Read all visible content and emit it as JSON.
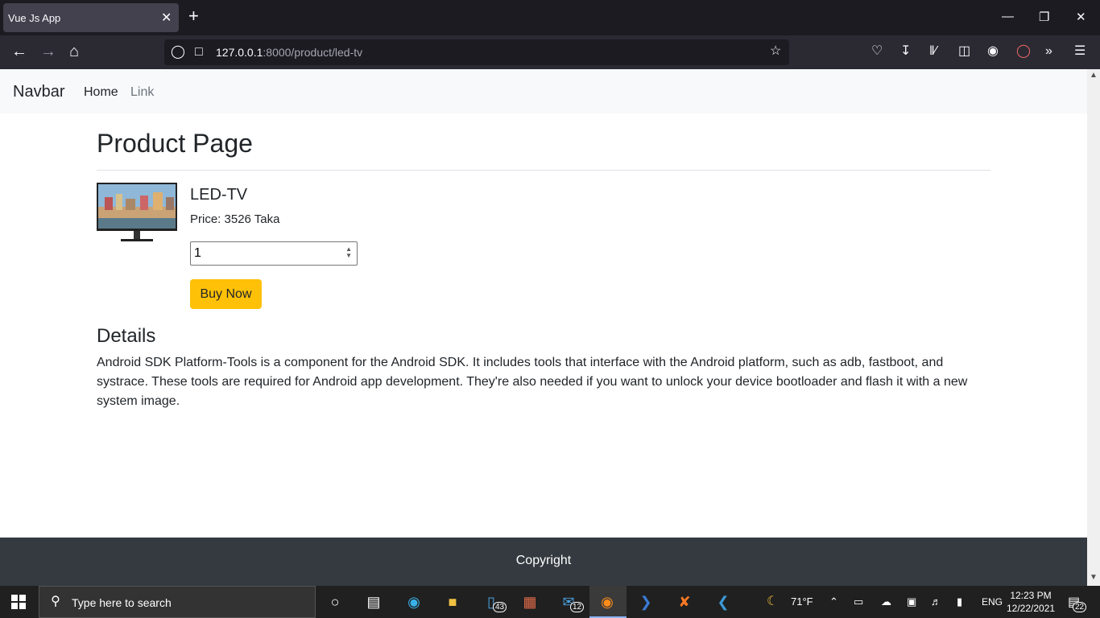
{
  "browser": {
    "tab_title": "Vue Js App",
    "tab_close": "✕",
    "new_tab": "+",
    "url_host": "127.0.0.1",
    "url_rest": ":8000/product/led-tv"
  },
  "navbar": {
    "brand": "Navbar",
    "home": "Home",
    "link": "Link"
  },
  "page": {
    "title": "Product Page",
    "product_name": "LED-TV",
    "price": "Price: 3526 Taka",
    "quantity_value": "1",
    "buy_label": "Buy Now",
    "details_title": "Details",
    "details_text": "Android SDK Platform-Tools is a component for the Android SDK. It includes tools that interface with the Android platform, such as adb, fastboot, and systrace. These tools are required for Android app development. They're also needed if you want to unlock your device bootloader and flash it with a new system image."
  },
  "footer": {
    "text": "Copyright"
  },
  "taskbar": {
    "search_placeholder": "Type here to search",
    "files_badge": "43",
    "mail_badge": "12",
    "weather": "71°F",
    "language": "ENG",
    "time": "12:23 PM",
    "date": "12/22/2021",
    "notifications": "22"
  },
  "colors": {
    "accent_button": "#ffc107",
    "footer_bg": "#343a40",
    "navbar_bg": "#f8f9fa"
  }
}
